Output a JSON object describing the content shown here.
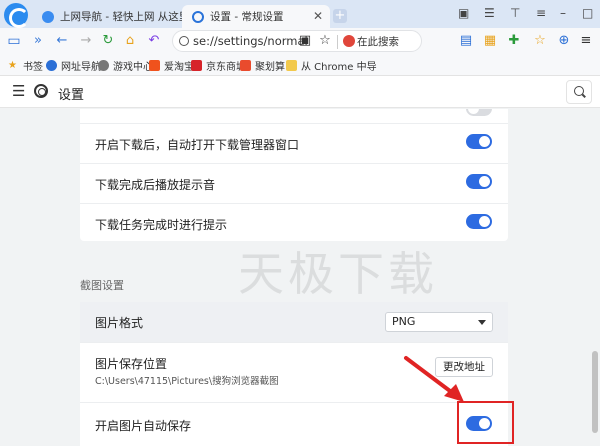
{
  "browser": {
    "tabs": [
      {
        "title": "上网导航 - 轻快上网 从这里开始",
        "active": false
      },
      {
        "title": "设置 - 常规设置",
        "active": true
      }
    ],
    "address": "se://settings/normal",
    "search_engine_label": "在此搜索",
    "bookmarks": [
      "书签",
      "网址导航",
      "游戏中心",
      "爱淘宝",
      "京东商城",
      "聚划算",
      "从 Chrome 中导"
    ]
  },
  "settings": {
    "title": "设置",
    "download_rows": [
      {
        "label": "开启下载后，自动打开下载管理器窗口",
        "enabled": true
      },
      {
        "label": "下载完成后播放提示音",
        "enabled": true
      },
      {
        "label": "下载任务完成时进行提示",
        "enabled": true
      }
    ],
    "screenshot_section": {
      "title": "截图设置",
      "format_label": "图片格式",
      "format_value": "PNG",
      "save_location_label": "图片保存位置",
      "save_path": "C:\\Users\\47115\\Pictures\\搜狗浏览器截图",
      "change_button": "更改地址",
      "autosave_label": "开启图片自动保存",
      "autosave_enabled": true
    }
  },
  "watermark": "天极下载",
  "colors": {
    "accent": "#2d6be1",
    "annotation": "#e02424"
  }
}
